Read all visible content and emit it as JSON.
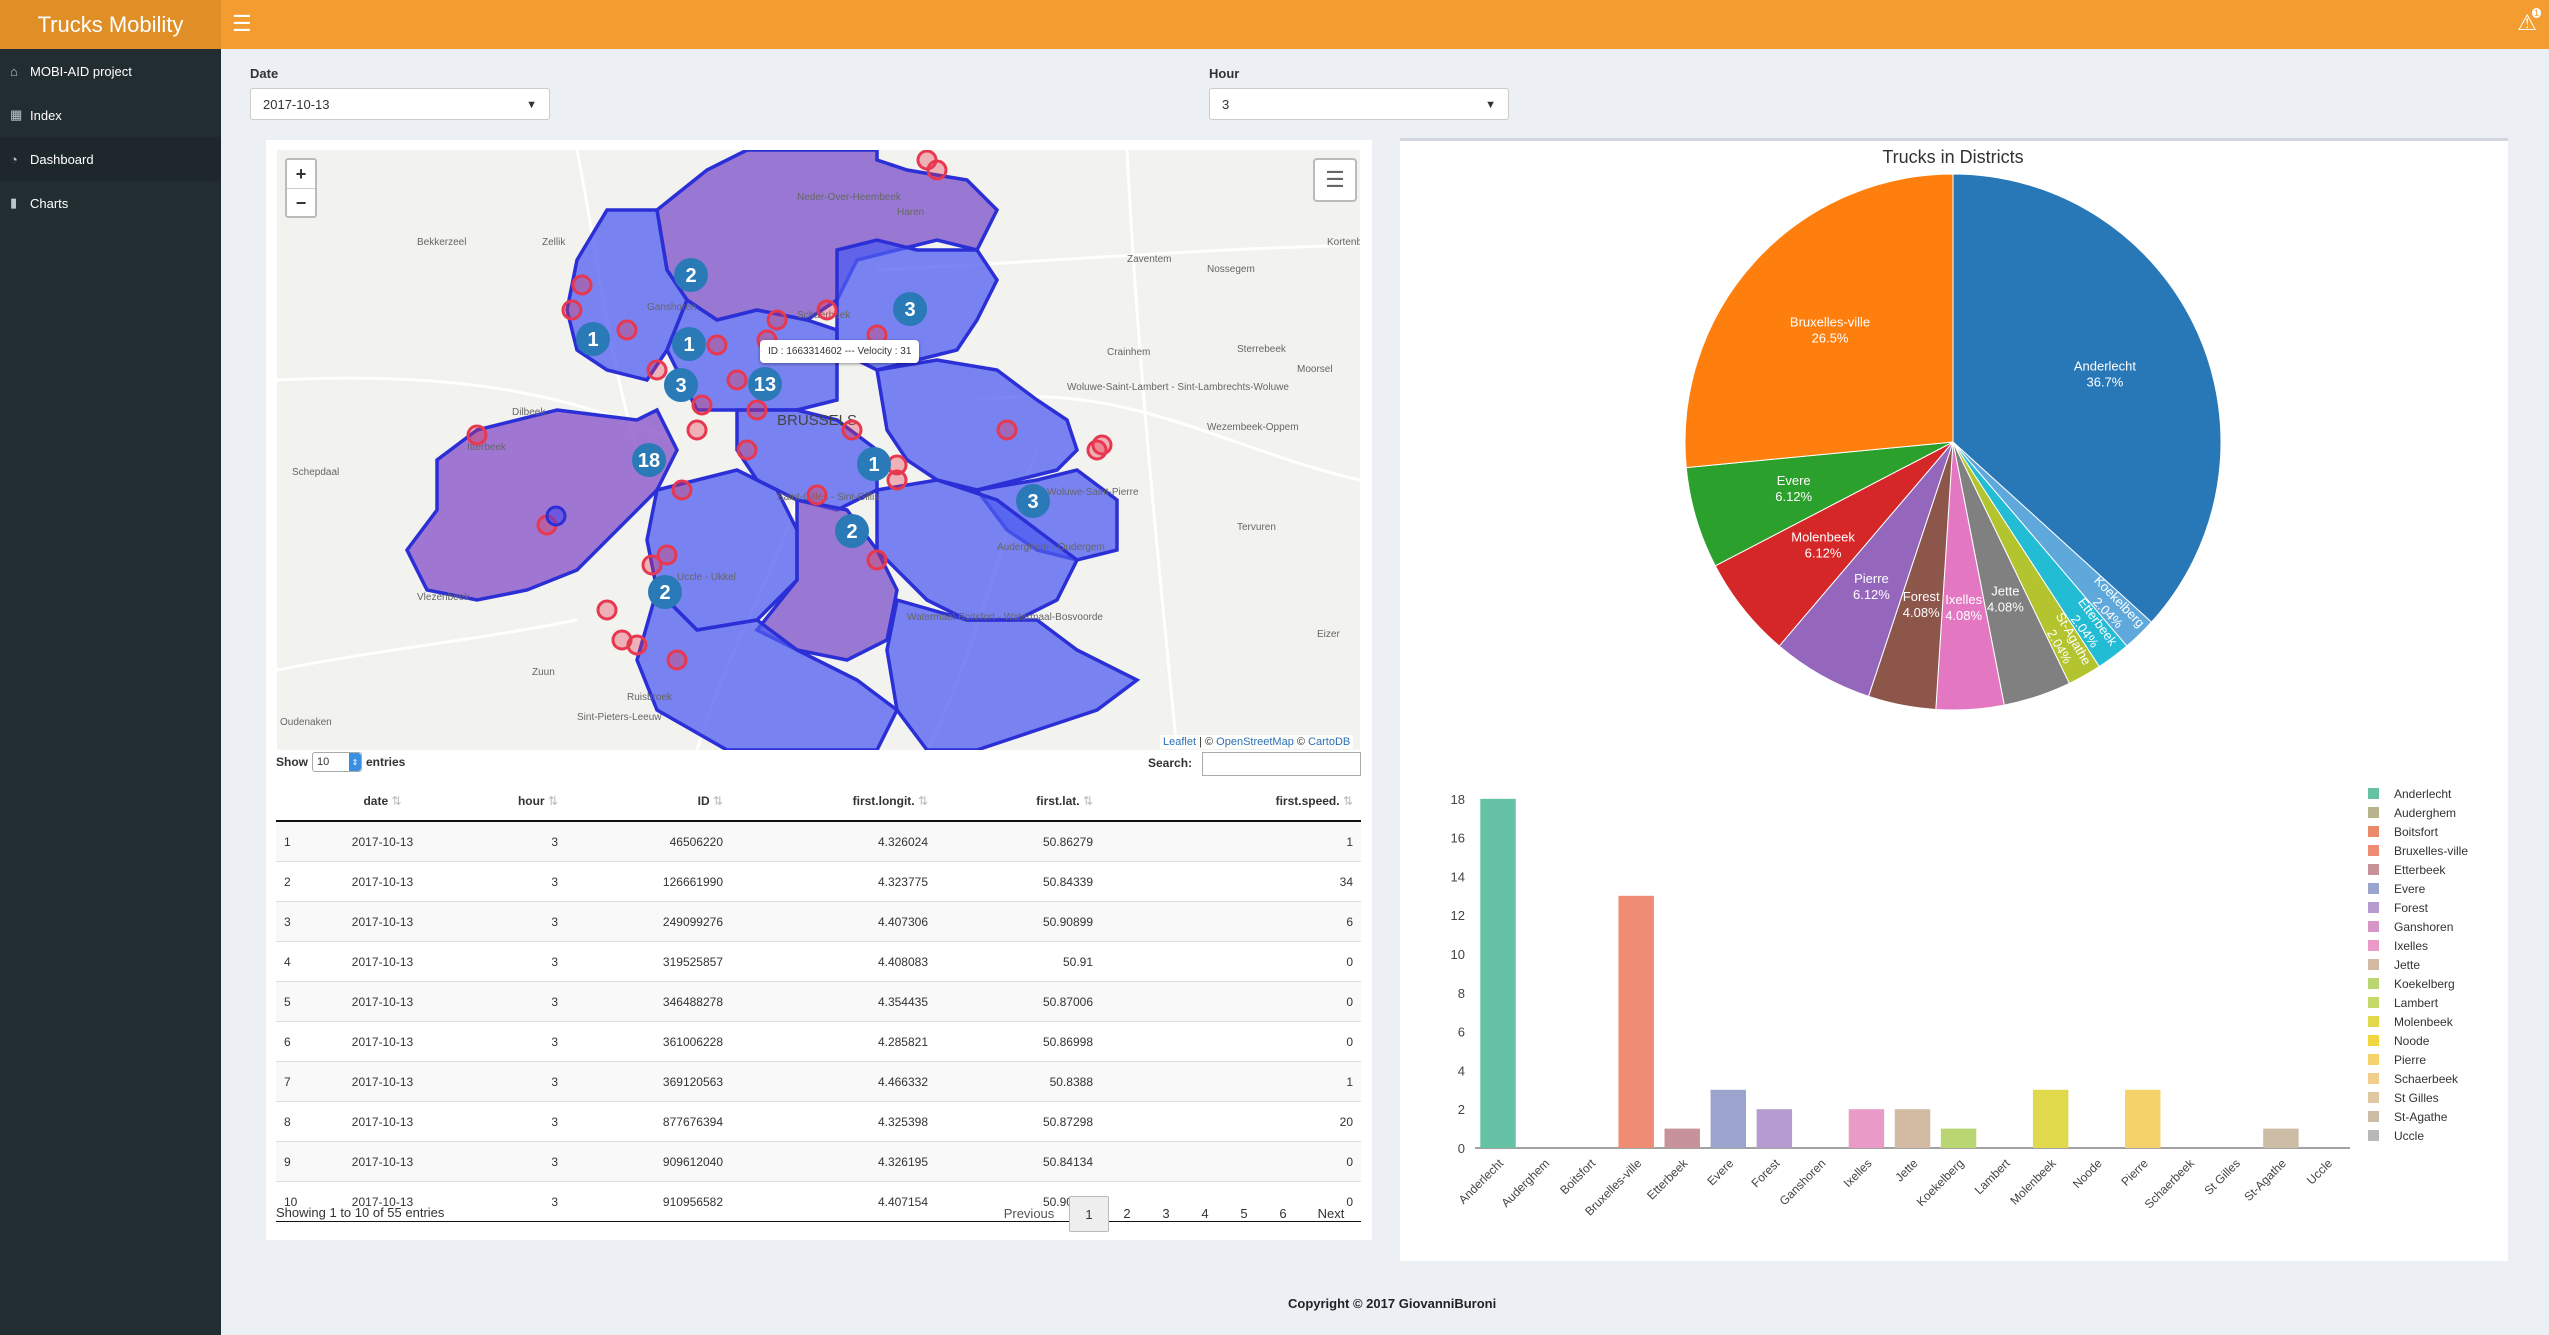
{
  "app": {
    "title": "Trucks Mobility",
    "menu_icon": "hamburger-icon",
    "alert_icon": "bell-icon",
    "alert_count": "1"
  },
  "sidebar": {
    "items": [
      {
        "label": "MOBI-AID project",
        "icon": "home-icon"
      },
      {
        "label": "Index",
        "icon": "table-icon"
      },
      {
        "label": "Dashboard",
        "icon": "dashboard-icon"
      },
      {
        "label": "Charts",
        "icon": "chart-icon"
      }
    ]
  },
  "filters": {
    "date_label": "Date",
    "date_value": "2017-10-13",
    "hour_label": "Hour",
    "hour_value": "3"
  },
  "map": {
    "zoom_in": "+",
    "zoom_out": "−",
    "labels": [
      {
        "text": "Neder-Over-Heembeek"
      },
      {
        "text": "Haren"
      },
      {
        "text": "Bekkerzeel"
      },
      {
        "text": "Zellik"
      },
      {
        "text": "Zaventem"
      },
      {
        "text": "Kortenberg"
      },
      {
        "text": "Nossegem"
      },
      {
        "text": "Ganshoren"
      },
      {
        "text": "Schaerbeek"
      },
      {
        "text": "Crainhem"
      },
      {
        "text": "Sterrebeek"
      },
      {
        "text": "Moorsel"
      },
      {
        "text": "Dilbeek"
      },
      {
        "text": "Itterbeek"
      },
      {
        "text": "BRUSSELS"
      },
      {
        "text": "Woluwe-Saint-Lambert - Sint-Lambrechts-Woluwe"
      },
      {
        "text": "Wezembeek-Oppem"
      },
      {
        "text": "Schepdaal"
      },
      {
        "text": "Saint-Gilles - Sint-Gillis"
      },
      {
        "text": "Woluwe-Saint-Pierre"
      },
      {
        "text": "Tervuren"
      },
      {
        "text": "Auderghem - Oudergem"
      },
      {
        "text": "Vlezenbeek"
      },
      {
        "text": "Uccle - Ukkel"
      },
      {
        "text": "Watermael-Boitsfort - Watermaal-Bosvoorde"
      },
      {
        "text": "Zuun"
      },
      {
        "text": "Eizer"
      },
      {
        "text": "Oudenaken"
      },
      {
        "text": "Sint-Pieters-Leeuw"
      },
      {
        "text": "Ruisbroek"
      }
    ],
    "clusters": [
      {
        "n": "2"
      },
      {
        "n": "3"
      },
      {
        "n": "1"
      },
      {
        "n": "1"
      },
      {
        "n": "3"
      },
      {
        "n": "13"
      },
      {
        "n": "18"
      },
      {
        "n": "1"
      },
      {
        "n": "3"
      },
      {
        "n": "2"
      },
      {
        "n": "2"
      }
    ],
    "tooltip": "ID : 1663314602 --- Velocity : 31",
    "attribution": {
      "leaflet": "Leaflet",
      "sep1": " | © ",
      "osm": "OpenStreetMap",
      "sep2": " © ",
      "carto": "CartoDB"
    },
    "colors": {
      "district": "#4a5ff0",
      "district_alt": "#7b4fc8",
      "point": "#e8384f",
      "cluster": "#2a7ab8"
    }
  },
  "table": {
    "show_label": "Show",
    "entries_value": "10",
    "entries_label": "entries",
    "search_label": "Search:",
    "columns": [
      "",
      "date",
      "hour",
      "ID",
      "first.longit.",
      "first.lat.",
      "first.speed."
    ],
    "rows": [
      [
        "1",
        "2017-10-13",
        "3",
        "46506220",
        "4.326024",
        "50.86279",
        "1"
      ],
      [
        "2",
        "2017-10-13",
        "3",
        "126661990",
        "4.323775",
        "50.84339",
        "34"
      ],
      [
        "3",
        "2017-10-13",
        "3",
        "249099276",
        "4.407306",
        "50.90899",
        "6"
      ],
      [
        "4",
        "2017-10-13",
        "3",
        "319525857",
        "4.408083",
        "50.91",
        "0"
      ],
      [
        "5",
        "2017-10-13",
        "3",
        "346488278",
        "4.354435",
        "50.87006",
        "0"
      ],
      [
        "6",
        "2017-10-13",
        "3",
        "361006228",
        "4.285821",
        "50.86998",
        "0"
      ],
      [
        "7",
        "2017-10-13",
        "3",
        "369120563",
        "4.466332",
        "50.8388",
        "1"
      ],
      [
        "8",
        "2017-10-13",
        "3",
        "877676394",
        "4.325398",
        "50.87298",
        "20"
      ],
      [
        "9",
        "2017-10-13",
        "3",
        "909612040",
        "4.326195",
        "50.84134",
        "0"
      ],
      [
        "10",
        "2017-10-13",
        "3",
        "910956582",
        "4.407154",
        "50.90879",
        "0"
      ]
    ],
    "info": "Showing 1 to 10 of 55 entries",
    "pager": {
      "previous": "Previous",
      "pages": [
        "1",
        "2",
        "3",
        "4",
        "5",
        "6"
      ],
      "next": "Next"
    }
  },
  "chart_data": [
    {
      "type": "pie",
      "title": "Trucks in Districts",
      "slices": [
        {
          "label": "Anderlecht",
          "pct": "36.7%",
          "value": 36.7,
          "color": "#2878b8"
        },
        {
          "label": "Koekelberg",
          "pct": "2.04%",
          "value": 2.04,
          "color": "#5fa8dc"
        },
        {
          "label": "Etterbeek",
          "pct": "2.04%",
          "value": 2.04,
          "color": "#22bcd4"
        },
        {
          "label": "St-Agathe",
          "pct": "2.04%",
          "value": 2.04,
          "color": "#b3c42e"
        },
        {
          "label": "Jette",
          "pct": "4.08%",
          "value": 4.08,
          "color": "#808080"
        },
        {
          "label": "Ixelles",
          "pct": "4.08%",
          "value": 4.08,
          "color": "#e377c2"
        },
        {
          "label": "Forest",
          "pct": "4.08%",
          "value": 4.08,
          "color": "#8c564b"
        },
        {
          "label": "Pierre",
          "pct": "6.12%",
          "value": 6.12,
          "color": "#9467bd"
        },
        {
          "label": "Molenbeek",
          "pct": "6.12%",
          "value": 6.12,
          "color": "#d62728"
        },
        {
          "label": "Evere",
          "pct": "6.12%",
          "value": 6.12,
          "color": "#2ca02c"
        },
        {
          "label": "Bruxelles-ville",
          "pct": "26.5%",
          "value": 26.5,
          "color": "#ff7f0e"
        }
      ]
    },
    {
      "type": "bar",
      "categories": [
        "Anderlecht",
        "Auderghem",
        "Boitsfort",
        "Bruxelles-ville",
        "Etterbeek",
        "Evere",
        "Forest",
        "Ganshoren",
        "Ixelles",
        "Jette",
        "Koekelberg",
        "Lambert",
        "Molenbeek",
        "Noode",
        "Pierre",
        "Schaerbeek",
        "St Gilles",
        "St-Agathe",
        "Uccle"
      ],
      "values": [
        18,
        0,
        0,
        13,
        1,
        3,
        2,
        0,
        2,
        2,
        1,
        0,
        3,
        0,
        3,
        0,
        0,
        1,
        0
      ],
      "colors": [
        "#66c2a5",
        "#b9b38c",
        "#e98a6a",
        "#ee8c74",
        "#c8929a",
        "#9aa4cc",
        "#b59bcf",
        "#d596c8",
        "#e99ac6",
        "#d2bba2",
        "#b9d673",
        "#c5d968",
        "#e0d94c",
        "#f0d640",
        "#f6d36a",
        "#f0cf8e",
        "#e0c7a4",
        "#cdbca6",
        "#b8b8b8"
      ],
      "yticks": [
        "0",
        "2",
        "4",
        "6",
        "8",
        "10",
        "12",
        "14",
        "16",
        "18"
      ],
      "ylim": [
        0,
        18.3
      ],
      "legend": "right"
    }
  ],
  "footer": "Copyright © 2017 GiovanniBuroni"
}
